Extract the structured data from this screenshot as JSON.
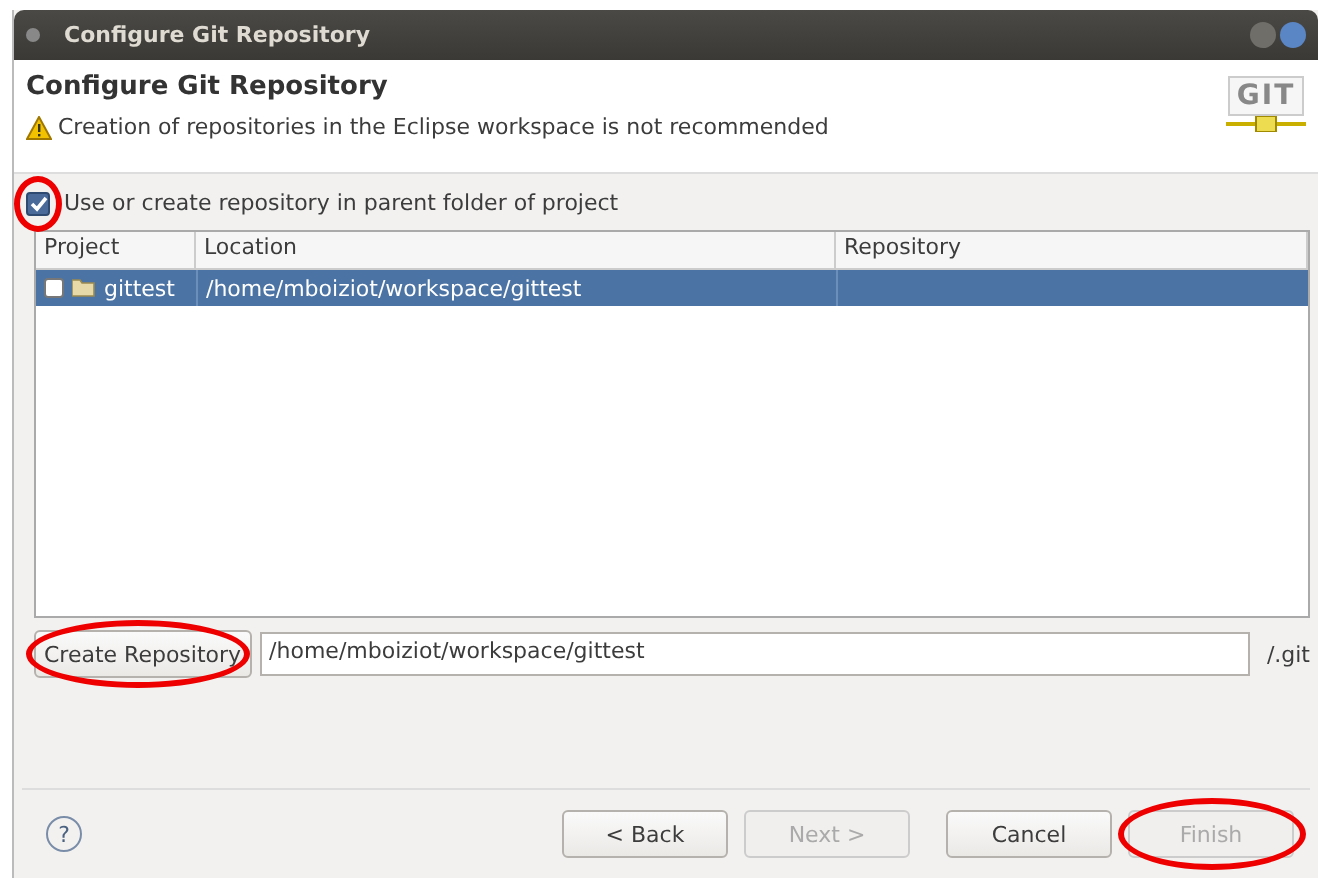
{
  "window": {
    "title": "Configure Git Repository"
  },
  "header": {
    "title": "Configure Git Repository",
    "warning": "Creation of repositories in the Eclipse workspace is not recommended",
    "logo": "GIT"
  },
  "parent_folder_option": {
    "label": "Use or create repository in parent folder of project",
    "checked": true,
    "highlighted": true
  },
  "table": {
    "columns": [
      "Project",
      "Location",
      "Repository"
    ],
    "rows": [
      {
        "checked": false,
        "selected": true,
        "project": "gittest",
        "location": "/home/mboiziot/workspace/gittest",
        "repository": ""
      }
    ]
  },
  "create": {
    "button": "Create Repository",
    "highlighted": true,
    "path": "/home/mboiziot/workspace/gittest",
    "suffix": "/.git"
  },
  "help": "?",
  "buttons": [
    {
      "label": "< Back",
      "disabled": false,
      "highlighted": false
    },
    {
      "label": "Next >",
      "disabled": true,
      "highlighted": false
    },
    {
      "label": "Cancel",
      "disabled": false,
      "highlighted": false
    },
    {
      "label": "Finish",
      "disabled": true,
      "highlighted": true
    }
  ]
}
